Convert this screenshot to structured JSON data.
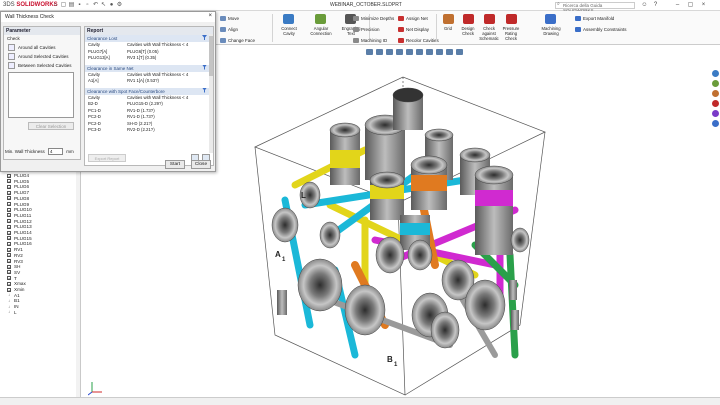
{
  "window": {
    "file_title": "WEBINAR_OCTOBER.SLDPRT",
    "help_search_placeholder": "Ricerca della Guida SOLIDWORKS",
    "logo_prefix": "3DS",
    "logo_text": "SOLIDWORKS"
  },
  "ribbon": {
    "small_left": [
      "Move",
      "Align",
      "Change Face"
    ],
    "big": [
      {
        "label": "Connect\nCavity",
        "color": "#3a7bc4"
      },
      {
        "label": "Angular\nConnection",
        "color": "#6a9c3a"
      },
      {
        "label": "Engraving\nText",
        "color": "#555555"
      }
    ],
    "mid_list": [
      "Minimize Depths",
      "Precision",
      "Machining ID"
    ],
    "net_list": [
      "Assign Net",
      "Net Display",
      "Recolor Cavities"
    ],
    "big_right": [
      {
        "label": "Grid",
        "color": "#c07030"
      },
      {
        "label": "Design\nCheck",
        "color": "#c02a2a"
      },
      {
        "label": "Check\nagainst\nSchematic",
        "color": "#c02a2a"
      },
      {
        "label": "Pressure\nRating\nCheck",
        "color": "#c02a2a"
      },
      {
        "label": "Machining\nDrawing",
        "color": "#3a6ec8"
      }
    ],
    "export_list": [
      "Export Manifold",
      "Assembly Constraints"
    ]
  },
  "dialog": {
    "title": "Wall Thickness Check",
    "parameter_header": "Parameter",
    "check_label": "Check",
    "check_options": [
      "Around all Cavities",
      "Around Selected Cavities",
      "Between Selected Cavities"
    ],
    "clear_selection": "Clear Selection",
    "min_wall_label": "Min. Wall Thickness",
    "min_wall_value": "4",
    "min_wall_unit": "mm",
    "report_header": "Report",
    "start_button": "Start",
    "close_button": "Close",
    "export_button": "Export Report",
    "groups": [
      {
        "title": "Clearance Lost",
        "col1": "Cavity",
        "col2": "Cavities with Wall Thickness < 4",
        "rows": [
          [
            "PLUG7[A]",
            "PLUG6[T] (0.05)"
          ],
          [
            "PLUG13[A]",
            "RV3 1[T] (0.35)"
          ]
        ]
      },
      {
        "title": "Clearance in Same Net",
        "col1": "Cavity",
        "col2": "Cavities with Wall Thickness < 4",
        "rows": [
          [
            "A1[A]",
            "RV1 1[A] (0.53?)"
          ]
        ]
      },
      {
        "title": "Clearance with Spot Face/Counterbore",
        "col1": "Cavity",
        "col2": "Cavities with Wall Thickness < 4",
        "rows": [
          [
            "B2-D",
            "PLUG15-D (2.29?)"
          ],
          [
            "PC1-D",
            "RV1-D (1.73?)"
          ],
          [
            "PC2-D",
            "RV1-D (1.73?)"
          ],
          [
            "PC2-D",
            "SH-D (2.21?)"
          ],
          [
            "PC3-D",
            "RV2-D (2.21?)"
          ]
        ]
      }
    ]
  },
  "feature_tree": {
    "items": [
      {
        "icon": "x",
        "label": "PLUG4"
      },
      {
        "icon": "x",
        "label": "PLUG5"
      },
      {
        "icon": "x",
        "label": "PLUG6"
      },
      {
        "icon": "x",
        "label": "PLUG7"
      },
      {
        "icon": "x",
        "label": "PLUG8"
      },
      {
        "icon": "x",
        "label": "PLUG9"
      },
      {
        "icon": "x",
        "label": "PLUG10"
      },
      {
        "icon": "x",
        "label": "PLUG11"
      },
      {
        "icon": "x",
        "label": "PLUG12"
      },
      {
        "icon": "x",
        "label": "PLUG13"
      },
      {
        "icon": "x",
        "label": "PLUG14"
      },
      {
        "icon": "x",
        "label": "PLUG15"
      },
      {
        "icon": "x",
        "label": "PLUG16"
      },
      {
        "icon": "x",
        "label": "RV1"
      },
      {
        "icon": "x",
        "label": "RV2"
      },
      {
        "icon": "x",
        "label": "RV3"
      },
      {
        "icon": "x",
        "label": "SH"
      },
      {
        "icon": "x",
        "label": "SV"
      },
      {
        "icon": "x",
        "label": "T"
      },
      {
        "icon": "x",
        "label": "Xmax"
      },
      {
        "icon": "x",
        "label": "Xmin"
      },
      {
        "icon": "p",
        "label": "A1"
      },
      {
        "icon": "p",
        "label": "B1"
      },
      {
        "icon": "p",
        "label": "IN"
      },
      {
        "icon": "p",
        "label": "L"
      }
    ]
  },
  "viewport": {
    "labels": [
      "L",
      "A",
      "1",
      "B",
      "1"
    ]
  },
  "colors": {
    "accent_blue": "#2a4a80",
    "pipe_yellow": "#e2d51a",
    "pipe_cyan": "#1bb8d8",
    "pipe_magenta": "#d02ad0",
    "pipe_orange": "#e07a20",
    "pipe_green": "#2aa04a",
    "port_grey": "#8c8c8c"
  }
}
